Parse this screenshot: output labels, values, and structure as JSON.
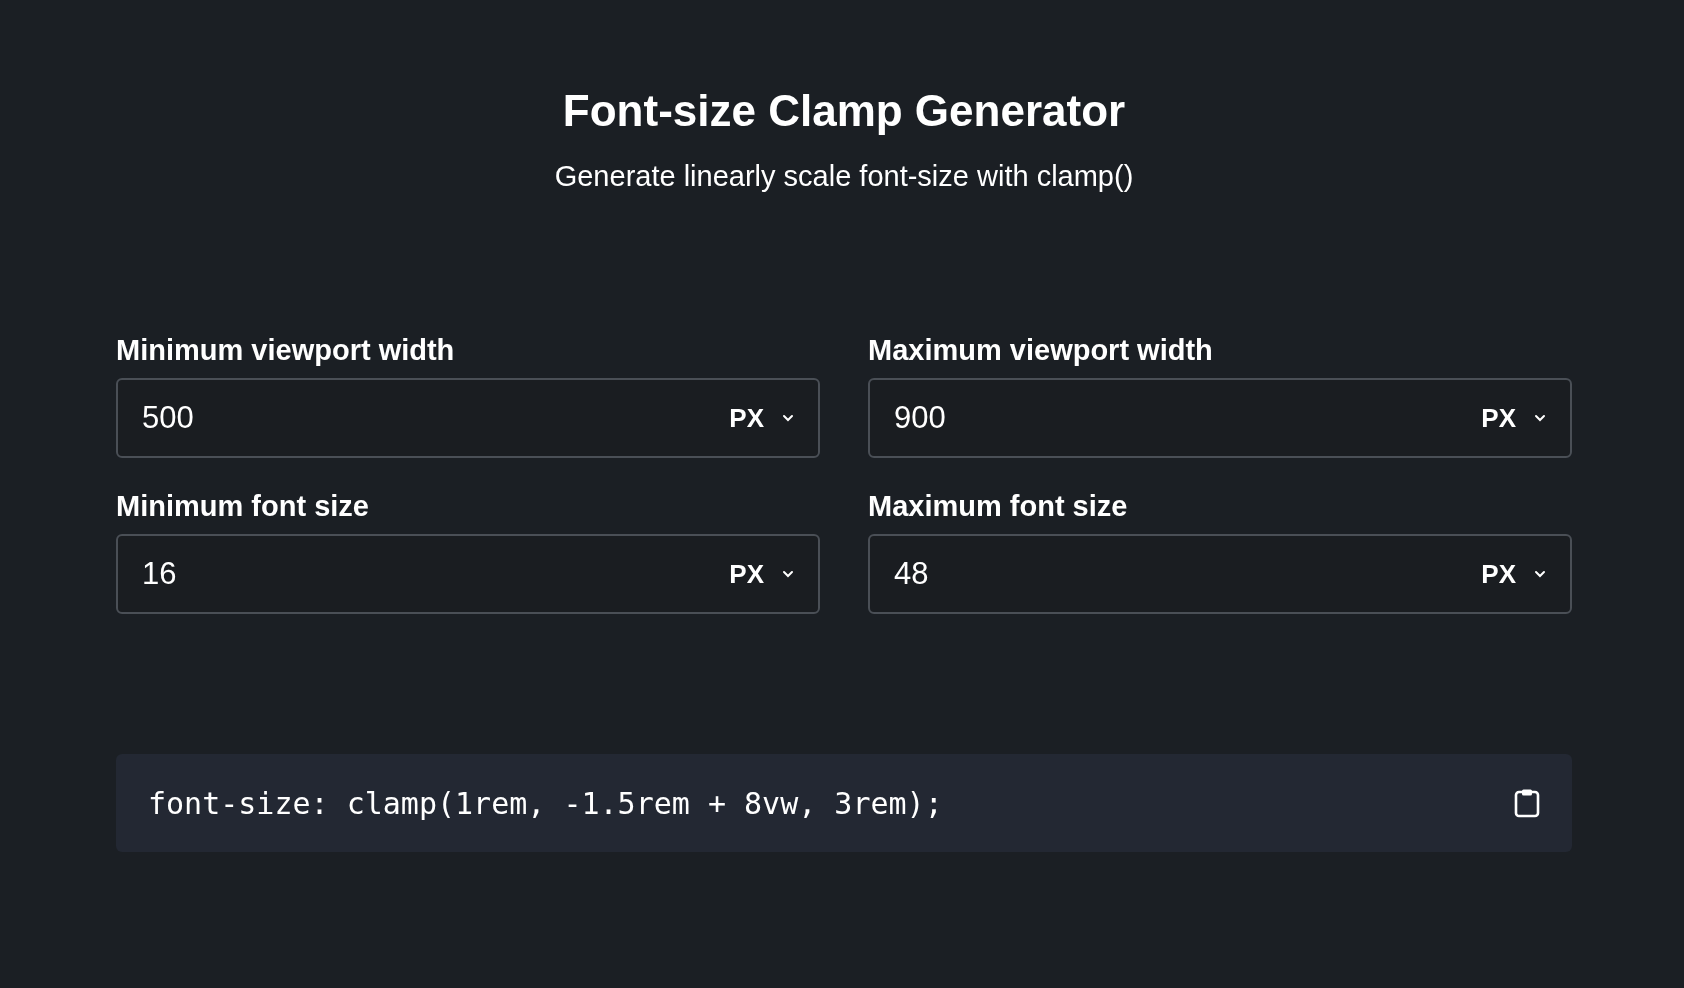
{
  "header": {
    "title": "Font-size Clamp Generator",
    "subtitle": "Generate linearly scale font-size with clamp()"
  },
  "fields": [
    {
      "label": "Minimum viewport width",
      "value": "500",
      "unit": "PX"
    },
    {
      "label": "Maximum viewport width",
      "value": "900",
      "unit": "PX"
    },
    {
      "label": "Minimum font size",
      "value": "16",
      "unit": "PX"
    },
    {
      "label": "Maximum font size",
      "value": "48",
      "unit": "PX"
    }
  ],
  "output": {
    "code": "font-size: clamp(1rem, -1.5rem + 8vw, 3rem);"
  }
}
